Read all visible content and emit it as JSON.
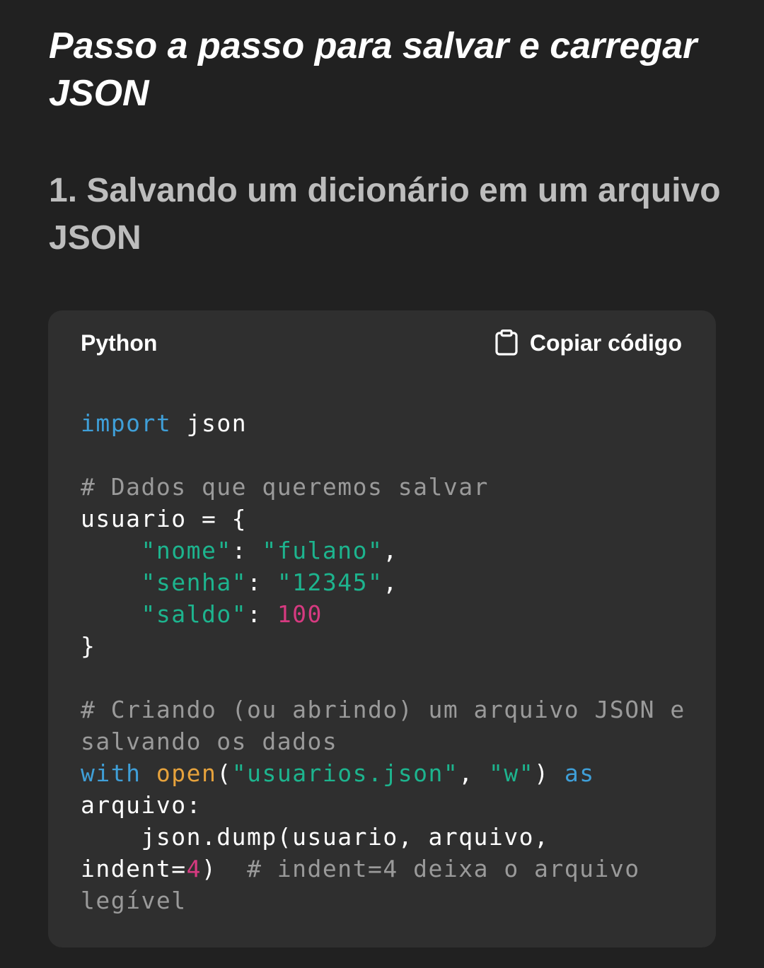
{
  "title": "Passo a passo para salvar e carregar JSON",
  "section": {
    "heading": "1. Salvando um dicionário em um arquivo JSON"
  },
  "code_block": {
    "language": "Python",
    "copy_label": "Copiar código",
    "copy_icon": "clipboard-icon",
    "tokens": {
      "import_kw": "import",
      "json_module": " json",
      "comment_1": "# Dados que queremos salvar",
      "usuario_assign": "usuario = {",
      "indent": "    ",
      "key_nome": "\"nome\"",
      "colon_sp": ": ",
      "val_nome": "\"fulano\"",
      "comma": ",",
      "key_senha": "\"senha\"",
      "val_senha": "\"12345\"",
      "key_saldo": "\"saldo\"",
      "val_saldo": "100",
      "close_brace": "}",
      "comment_2a": "# Criando (ou abrindo) um arquivo JSON e",
      "comment_2b": "salvando os dados",
      "with_kw": "with",
      "space": " ",
      "open_fn": "open",
      "paren_open": "(",
      "str_filename": "\"usuarios.json\"",
      "comma_sp": ", ",
      "str_mode": "\"w\"",
      "paren_close_sp": ") ",
      "as_kw": "as",
      "arquivo_colon": "arquivo:",
      "dump_call": "    json.dump(usuario, arquivo,",
      "indent_eq": "indent=",
      "num_4": "4",
      "close_paren_gap": ")  ",
      "comment_3a": "# indent=4 deixa o arquivo",
      "comment_3b": "legível"
    }
  },
  "colors": {
    "background": "#212121",
    "code_background": "#2f2f2f",
    "keyword": "#3f9fd8",
    "builtin": "#e6a23c",
    "string": "#1db48e",
    "number": "#d63a80",
    "comment": "#9a9a9a"
  }
}
